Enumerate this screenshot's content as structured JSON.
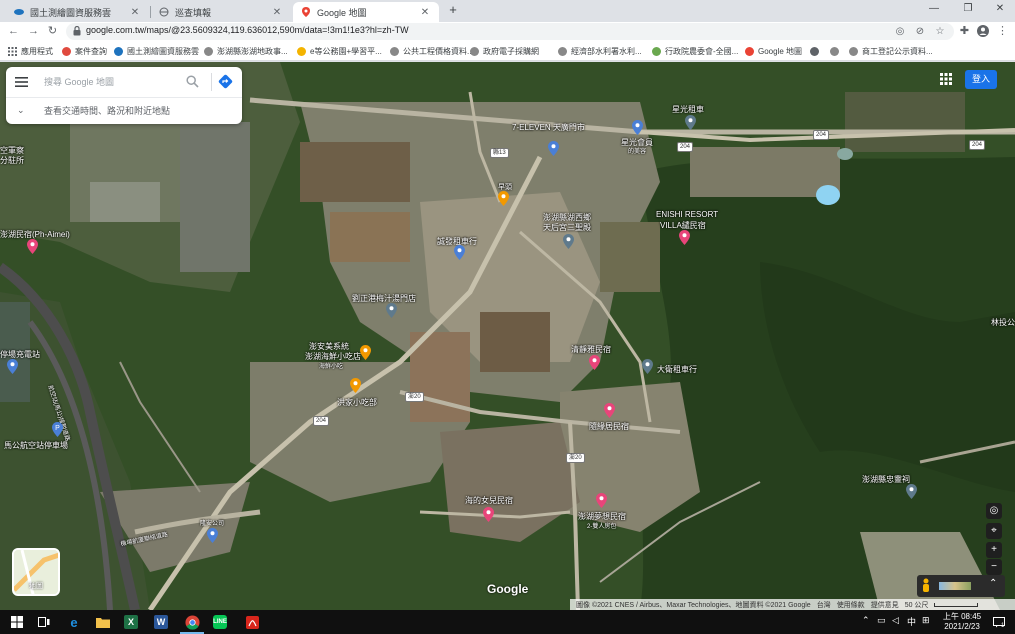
{
  "browser": {
    "tabs": [
      {
        "title": "國土測繪圖資服務雲",
        "active": false
      },
      {
        "title": "巡查填報",
        "active": false
      },
      {
        "title": "Google 地圖",
        "active": true
      }
    ],
    "url": "google.com.tw/maps/@23.5609324,119.636012,590m/data=!3m1!1e3?hl=zh-TW",
    "bookmarks": [
      "應用程式",
      "案件查詢",
      "國土測繪圖資服務雲",
      "澎湖縣澎湖地政事...",
      "e等公務園+學習平...",
      "公共工程價格資料...",
      "政府電子採購網",
      "經濟部水利署水利...",
      "行政院農委會-全國...",
      "Google 地圖",
      "商工登記公示資料..."
    ]
  },
  "maps": {
    "search_placeholder": "搜尋 Google 地圖",
    "explore_label": "查看交通時間、路況和附近地點",
    "sign_in": "登入",
    "layer_label": "地圖",
    "google_logo": "Google",
    "attribution": {
      "imagery": "圖像 ©2021 CNES / Airbus、Maxar Technologies、地圖資料 ©2021 Google",
      "region": "台灣",
      "terms": "使用條款",
      "feedback": "提供意見",
      "scale": "50 公尺"
    },
    "places": {
      "rental_top": "星光租車",
      "seven_eleven": "7-ELEVEN 天廣門市",
      "sports_club": "星光會員",
      "sports_sub": "的美容",
      "breakfast": "早頭",
      "temple_a": "澎湖縣湖西鄉",
      "temple_b": "天后宮三聖殿",
      "enishi_a": "ENISHI RESORT",
      "enishi_b": "VILLA繾民宿",
      "bank": "誠發租車行",
      "aimei": "澎湖民宿(Ph-Aimei)",
      "left_edge": "空軍察",
      "left_edge2": "分駐所",
      "shop_label": "劉正港梅汁湯門店",
      "restaurant_a": "澎安美系統",
      "restaurant_b": "澎湖海鮮小吃店",
      "restaurant_c": "海鮮小吃",
      "snack": "洪家小吃部",
      "qingxin": "清靜雅民宿",
      "rental_mid": "大衛租車行",
      "suiyuan": "隨緣居民宿",
      "charging": "停場充電站",
      "airport_parking": "馬公航空站停車場",
      "lin_edge": "林投公",
      "sea_house": "海的女兒民宿",
      "dream_home_a": "澎湖夢想民宿",
      "dream_home_b": "2-雙人房包",
      "loyalty": "澎湖縣忠靈祠",
      "airport_road": "機場航廈聯絡道路",
      "bus_stop": "隆安公司"
    },
    "roads": {
      "r204_a": "204",
      "r204_b": "204",
      "r204_c": "204",
      "r204_d": "204",
      "county_a": "縣13",
      "county_b": "澎20",
      "county_c": "澎20"
    },
    "airport_vertical": "航空站(馬公)接駁道路"
  },
  "taskbar": {
    "ime": "中",
    "time": "上午 08:45",
    "date": "2021/2/23",
    "notify": "1"
  },
  "colors": {
    "accent": "#1a73e8",
    "pin_red": "#e8457a",
    "pin_orange": "#f29900",
    "pin_blue": "#4a7fd6",
    "pin_gray": "#5f7a8c"
  }
}
